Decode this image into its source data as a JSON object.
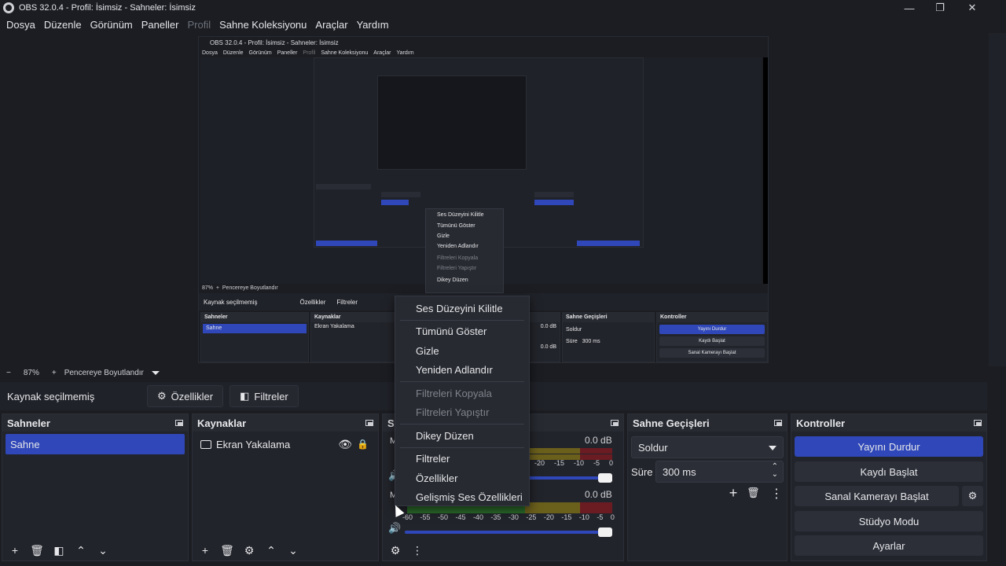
{
  "window": {
    "title": "OBS 32.0.4 - Profil: İsimsiz - Sahneler: İsimsiz",
    "minimize": "—",
    "maximize": "❐",
    "close": "✕"
  },
  "menu": [
    "Dosya",
    "Düzenle",
    "Görünüm",
    "Paneller",
    "Profil",
    "Sahne Koleksiyonu",
    "Araçlar",
    "Yardım"
  ],
  "nested": {
    "title": "OBS 32.0.4 - Profil: İsimsiz - Sahneler: İsimsiz",
    "menu": [
      "Dosya",
      "Düzenle",
      "Görünüm",
      "Paneller",
      "Profil",
      "Sahne Koleksiyonu",
      "Araçlar",
      "Yardım"
    ],
    "zoom": "87%",
    "fit_label": "Pencereye Boyutlandır",
    "no_source": "Kaynak seçilmemiş",
    "props": "Özellikler",
    "filters": "Filtreler",
    "scenes_title": "Sahneler",
    "scene_item": "Sahne",
    "sources_title": "Kaynaklar",
    "source_item": "Ekran Yakalama",
    "transitions_title": "Sahne Geçişleri",
    "transition": "Soldur",
    "duration_label": "Süre",
    "duration": "300 ms",
    "controls_title": "Kontroller",
    "controls": [
      "Yayını Durdur",
      "Kaydı Başlat",
      "Sanal Kamerayı Başlat",
      "Stüdyo Modu",
      "Ayarlar"
    ],
    "db1": "0.0 dB",
    "db2": "0.0 dB",
    "context": [
      "Ses Düzeyini Kilitle",
      "Tümünü Göster",
      "Gizle",
      "Yeniden Adlandır",
      "Filtreleri Kopyala",
      "Filtreleri Yapıştır",
      "Dikey Düzen"
    ]
  },
  "zoombar": {
    "minus": "−",
    "zoom": "87%",
    "plus": "+",
    "fit_label": "Pencereye Boyutlandır"
  },
  "source_toolbar": {
    "no_source": "Kaynak seçilmemiş",
    "properties": "Özellikler",
    "filters": "Filtreler"
  },
  "scenes": {
    "title": "Sahneler",
    "items": [
      "Sahne"
    ]
  },
  "sources": {
    "title": "Kaynaklar",
    "items": [
      "Ekran Yakalama"
    ]
  },
  "mixer": {
    "title": "S",
    "tracks": [
      {
        "label": "M",
        "db": "0.0 dB"
      },
      {
        "label": "M",
        "db": "0.0 dB"
      }
    ],
    "scale": [
      "-60",
      "-55",
      "-50",
      "-45",
      "-40",
      "-35",
      "-30",
      "-25",
      "-20",
      "-15",
      "-10",
      "-5",
      "0"
    ],
    "scale_partial": [
      "-20",
      "-15",
      "-10",
      "-5",
      "0"
    ]
  },
  "transitions": {
    "title": "Sahne Geçişleri",
    "selected": "Soldur",
    "duration_label": "Süre",
    "duration": "300 ms"
  },
  "controls": {
    "title": "Kontroller",
    "stop_stream": "Yayını Durdur",
    "start_record": "Kaydı Başlat",
    "start_vcam": "Sanal Kamerayı Başlat",
    "studio_mode": "Stüdyo Modu",
    "settings": "Ayarlar"
  },
  "context_menu": {
    "lock_volume": "Ses Düzeyini Kilitle",
    "show_all": "Tümünü Göster",
    "hide": "Gizle",
    "rename": "Yeniden Adlandır",
    "copy_filters": "Filtreleri Kopyala",
    "paste_filters": "Filtreleri Yapıştır",
    "vertical_layout": "Dikey Düzen",
    "filters": "Filtreler",
    "properties": "Özellikler",
    "advanced_audio": "Gelişmiş Ses Özellikleri"
  },
  "colors": {
    "background": "#1b1d23",
    "panel": "#22242b",
    "accent": "#2f47b8",
    "meter_green": "#2b6b2b",
    "meter_yellow": "#6b5f1c",
    "meter_red": "#6b1c22"
  }
}
